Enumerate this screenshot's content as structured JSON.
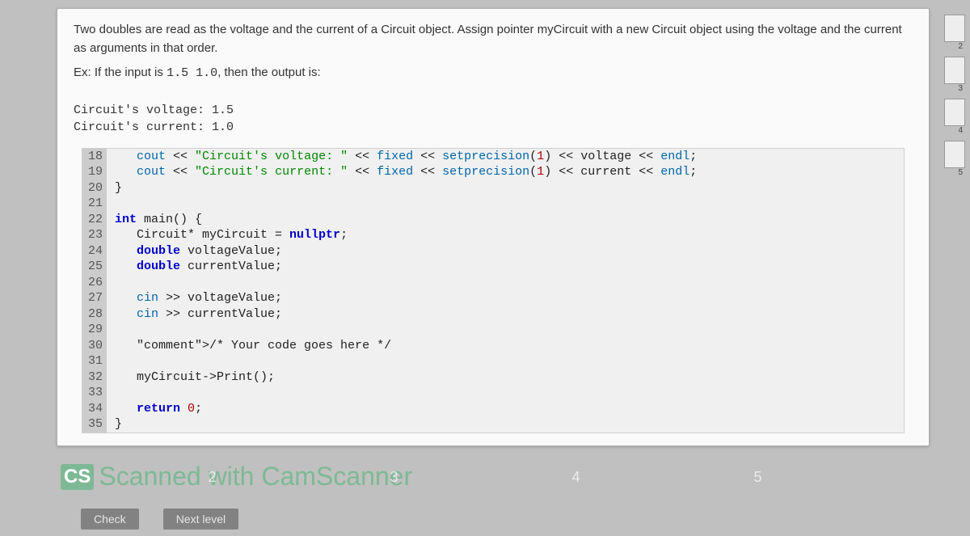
{
  "instruction": {
    "p1": "Two doubles are read as the voltage and the current of a Circuit object. Assign pointer myCircuit with a new Circuit object using the voltage and the current as arguments in that order.",
    "p2_prefix": "Ex: If the input is ",
    "p2_input": "1.5 1.0",
    "p2_suffix": ", then the output is:"
  },
  "output": {
    "line1": "Circuit's voltage: 1.5",
    "line2": "Circuit's current: 1.0"
  },
  "code": [
    {
      "n": "18",
      "t": "   cout << \"Circuit's voltage: \" << fixed << setprecision(1) << voltage << endl;"
    },
    {
      "n": "19",
      "t": "   cout << \"Circuit's current: \" << fixed << setprecision(1) << current << endl;"
    },
    {
      "n": "20",
      "t": "}"
    },
    {
      "n": "21",
      "t": ""
    },
    {
      "n": "22",
      "t": "int main() {"
    },
    {
      "n": "23",
      "t": "   Circuit* myCircuit = nullptr;"
    },
    {
      "n": "24",
      "t": "   double voltageValue;"
    },
    {
      "n": "25",
      "t": "   double currentValue;"
    },
    {
      "n": "26",
      "t": ""
    },
    {
      "n": "27",
      "t": "   cin >> voltageValue;"
    },
    {
      "n": "28",
      "t": "   cin >> currentValue;"
    },
    {
      "n": "29",
      "t": ""
    },
    {
      "n": "30",
      "t": "   /* Your code goes here */"
    },
    {
      "n": "31",
      "t": ""
    },
    {
      "n": "32",
      "t": "   myCircuit->Print();"
    },
    {
      "n": "33",
      "t": ""
    },
    {
      "n": "34",
      "t": "   return 0;"
    },
    {
      "n": "35",
      "t": "}"
    }
  ],
  "watermark": {
    "badge": "CS",
    "text": "Scanned with CamScanner"
  },
  "pagination": [
    "2",
    "3",
    "4",
    "5"
  ],
  "buttons": {
    "check": "Check",
    "next": "Next level"
  },
  "thumbs": [
    "2",
    "3",
    "4",
    "5"
  ]
}
